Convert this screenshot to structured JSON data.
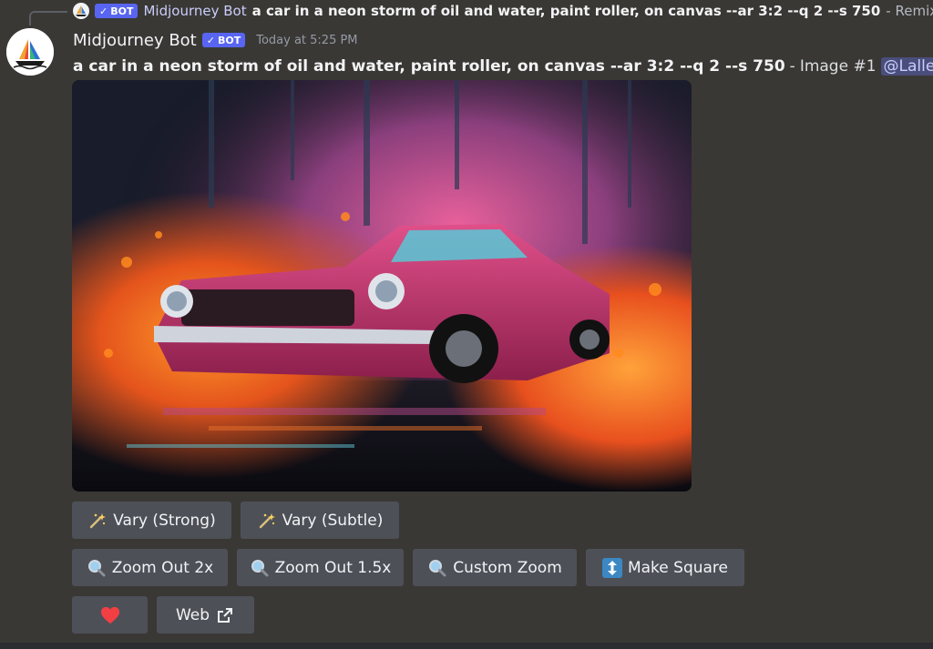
{
  "reply": {
    "bot_badge": "BOT",
    "author": "Midjourney Bot",
    "prompt": "a car in a neon storm of oil and water, paint roller, on canvas --ar 3:2 --q 2 --s 750",
    "suffix": "- Remix by"
  },
  "message": {
    "author": "Midjourney Bot",
    "bot_badge": "BOT",
    "timestamp": "Today at 5:25 PM",
    "prompt": "a car in a neon storm of oil and water, paint roller, on canvas --ar 3:2 --q 2 --s 750",
    "separator": "-",
    "image_label": "Image #1",
    "mention": "@Lallen"
  },
  "buttons": {
    "vary_strong": "Vary (Strong)",
    "vary_subtle": "Vary (Subtle)",
    "zoom_out_2x": "Zoom Out 2x",
    "zoom_out_1_5x": "Zoom Out 1.5x",
    "custom_zoom": "Custom Zoom",
    "make_square": "Make Square",
    "web": "Web"
  },
  "icons": {
    "vary": "magic-wand-icon",
    "zoom": "magnifier-icon",
    "make_square": "up-down-arrow-icon",
    "favorite": "heart-icon",
    "web": "external-link-icon"
  },
  "colors": {
    "background": "#3a3835",
    "button": "#4e5058",
    "bot_badge": "#5865f2",
    "heart": "#f23f43",
    "mention_bg": "#4a4e7c"
  }
}
